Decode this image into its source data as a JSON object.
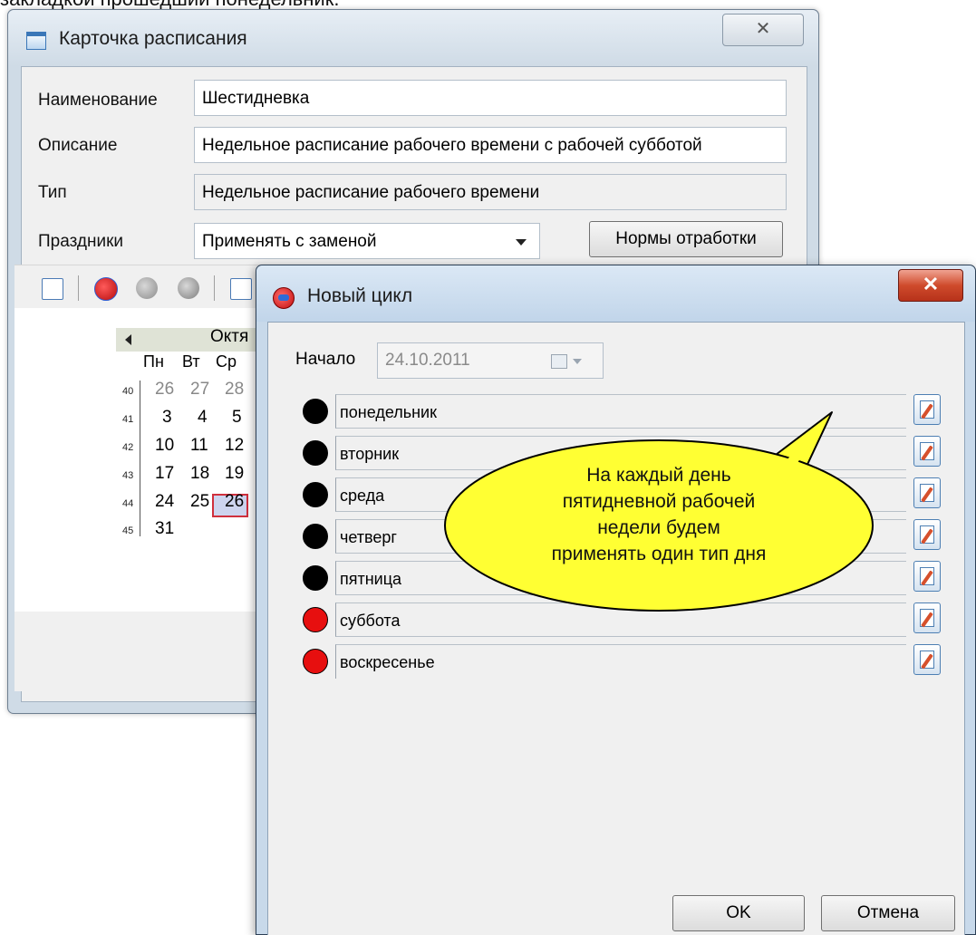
{
  "top_caption": "закладкой прошедший понедельник.",
  "schedule_card": {
    "title": "Карточка расписания",
    "close_glyph": "✕",
    "name_label": "Наименование",
    "name_value": "Шестидневка",
    "description_label": "Описание",
    "description_value": "Недельное расписание рабочего времени с рабочей субботой",
    "type_label": "Тип",
    "type_value": "Недельное расписание рабочего времени",
    "holidays_label": "Праздники",
    "holidays_value": "Применять с заменой",
    "norms_button": "Нормы отработки",
    "calendar": {
      "month": "Октя",
      "weekdays": [
        "Пн",
        "Вт",
        "Ср"
      ],
      "weeks": [
        {
          "num": "40",
          "days": [
            "26",
            "27",
            "28"
          ],
          "other_month": true
        },
        {
          "num": "41",
          "days": [
            "3",
            "4",
            "5"
          ],
          "other_month": false
        },
        {
          "num": "42",
          "days": [
            "10",
            "11",
            "12"
          ],
          "other_month": false
        },
        {
          "num": "43",
          "days": [
            "17",
            "18",
            "19"
          ],
          "other_month": false
        },
        {
          "num": "44",
          "days": [
            "24",
            "25",
            "26"
          ],
          "other_month": false
        },
        {
          "num": "45",
          "days": [
            "31",
            "",
            ""
          ],
          "other_month": false
        }
      ],
      "today": "26"
    }
  },
  "new_cycle": {
    "title": "Новый цикл",
    "close_glyph": "✕",
    "start_label": "Начало",
    "start_value": "24.10.2011",
    "days": [
      {
        "label": "понедельник",
        "type": "black"
      },
      {
        "label": "вторник",
        "type": "black"
      },
      {
        "label": "среда",
        "type": "black"
      },
      {
        "label": "четверг",
        "type": "black"
      },
      {
        "label": "пятница",
        "type": "black"
      },
      {
        "label": "суббота",
        "type": "red"
      },
      {
        "label": "воскресенье",
        "type": "red"
      }
    ],
    "ok_button": "OK",
    "cancel_button": "Отмена"
  },
  "callout": {
    "lines": [
      "На каждый день",
      "пятидневной рабочей",
      "недели будем",
      "применять один тип дня"
    ],
    "fill_color": "#ffff33"
  }
}
